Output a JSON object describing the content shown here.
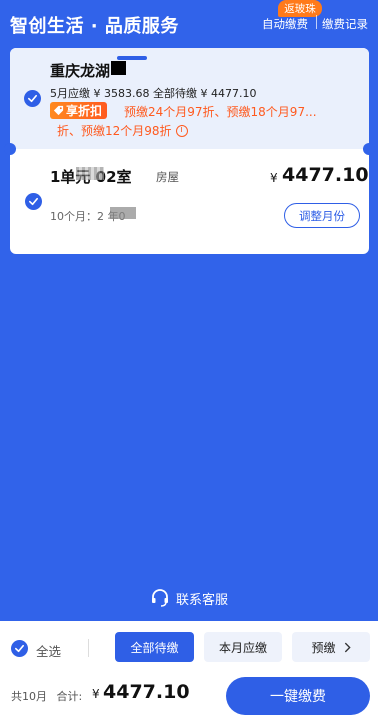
{
  "header": {
    "brand": "智创生活 · 品质服务",
    "badge": "返玻珠",
    "auto_pay": "自动缴费",
    "pay_record": "缴费记录"
  },
  "card": {
    "community": "重庆龙湖",
    "amounts": "5月应缴 ¥ 3583.68  全部待缴 ¥ 4477.10",
    "discount_tag": "享折扣",
    "discount_line1": "预缴24个月97折、预缴18个月97...",
    "discount_line2": "折、预缴12个月98折",
    "room": "1单元  02室",
    "room_type": "房屋",
    "price_yen": "¥",
    "price": "4477.10",
    "months_line": "10个月：2            年0",
    "adjust_button": "调整月份"
  },
  "contact": {
    "label": "联系客服"
  },
  "bottom": {
    "select_all": "全选",
    "tabs": [
      "全部待缴",
      "本月应缴",
      "预缴"
    ],
    "total_months": "共10月",
    "total_label": "合计:",
    "total_yen": "¥",
    "total_price": "4477.10",
    "pay_button": "一键缴费"
  },
  "colors": {
    "primary": "#2f5fe6",
    "background": "#3163ea",
    "discount": "#ff5a1f"
  }
}
